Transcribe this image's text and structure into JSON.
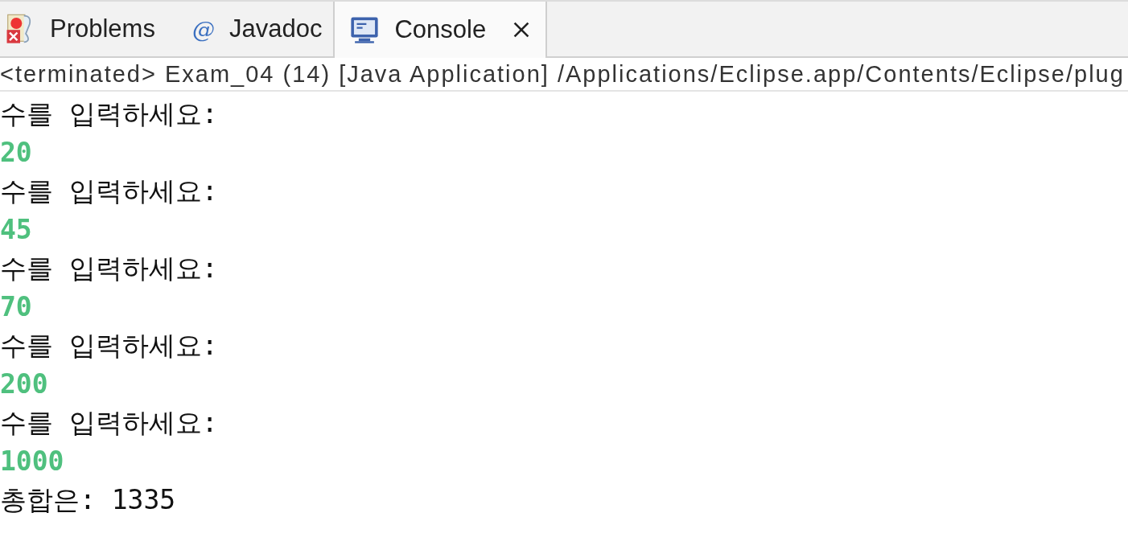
{
  "tabs": [
    {
      "kind": "problems",
      "label": "Problems",
      "selected": false
    },
    {
      "kind": "javadoc",
      "icon_char": "@",
      "label": "Javadoc",
      "selected": false
    },
    {
      "kind": "console",
      "label": "Console",
      "selected": true
    }
  ],
  "console": {
    "status": "<terminated> Exam_04 (14) [Java Application] /Applications/Eclipse.app/Contents/Eclipse/plug",
    "lines": [
      {
        "kind": "output",
        "text": "수를 입력하세요:"
      },
      {
        "kind": "input",
        "text": "20"
      },
      {
        "kind": "output",
        "text": "수를 입력하세요:"
      },
      {
        "kind": "input",
        "text": "45"
      },
      {
        "kind": "output",
        "text": "수를 입력하세요:"
      },
      {
        "kind": "input",
        "text": "70"
      },
      {
        "kind": "output",
        "text": "수를 입력하세요:"
      },
      {
        "kind": "input",
        "text": "200"
      },
      {
        "kind": "output",
        "text": "수를 입력하세요:"
      },
      {
        "kind": "input",
        "text": "1000"
      },
      {
        "kind": "output",
        "text": "총합은: 1335"
      }
    ]
  }
}
